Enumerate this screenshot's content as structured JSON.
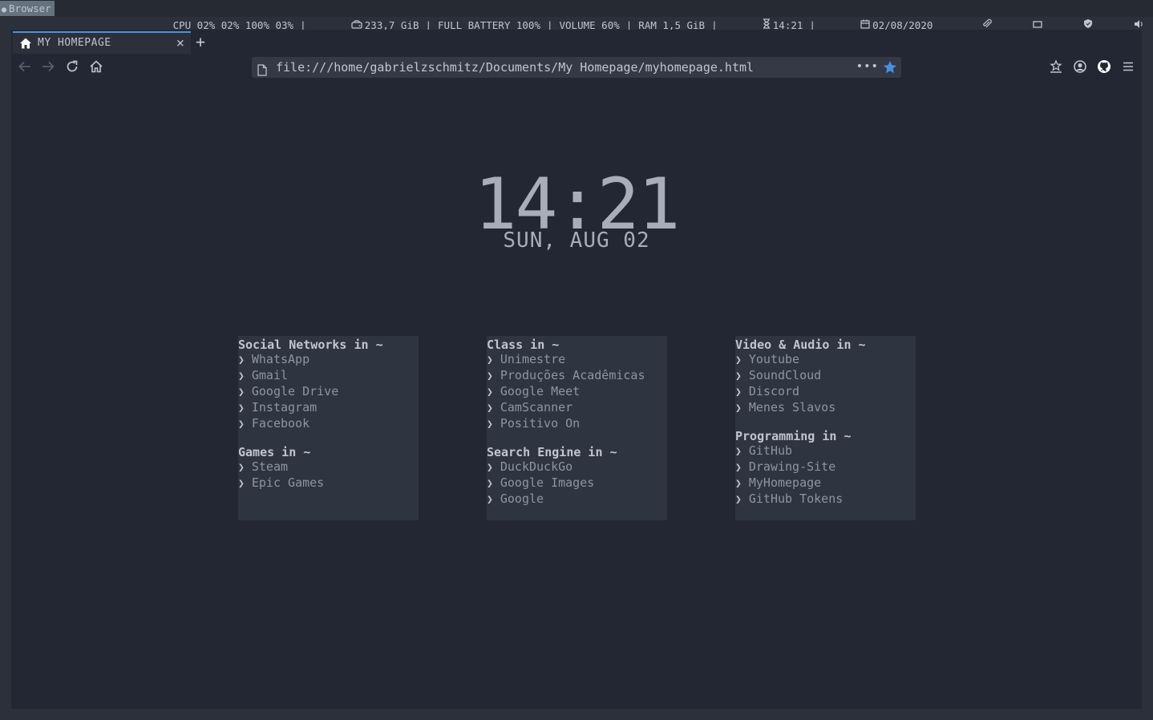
{
  "sysbar": {
    "workspace": "Browser",
    "cpu": "CPU 02% 02% 100% 03%",
    "disk": "233,7 GiB",
    "battery": "FULL BATTERY 100%",
    "volume": "VOLUME 60%",
    "ram": "RAM 1,5 GiB",
    "time": "14:21",
    "date": "02/08/2020",
    "icons": [
      "disk-icon",
      "hourglass-icon",
      "calendar-icon",
      "paperclip-icon",
      "window-icon",
      "shield-icon",
      "speaker-icon"
    ]
  },
  "browser": {
    "tab_title": "MY HOMEPAGE",
    "url": "file:///home/gabrielzschmitz/Documents/My Homepage/myhomepage.html",
    "accent": "#4a90e2"
  },
  "page": {
    "clock": "14:21",
    "date": "SUN, AUG 02",
    "columns": [
      {
        "groups": [
          {
            "heading": "Social Networks in ~",
            "links": [
              "WhatsApp",
              "Gmail",
              "Google Drive",
              "Instagram",
              "Facebook"
            ]
          },
          {
            "heading": "Games in ~",
            "links": [
              "Steam",
              "Epic Games"
            ]
          }
        ]
      },
      {
        "groups": [
          {
            "heading": "Class in ~",
            "links": [
              "Unimestre",
              "Produções Acadêmicas",
              "Google Meet",
              "CamScanner",
              "Positivo On"
            ]
          },
          {
            "heading": "Search Engine in ~",
            "links": [
              "DuckDuckGo",
              "Google Images",
              "Google"
            ]
          }
        ]
      },
      {
        "groups": [
          {
            "heading": "Video & Audio in ~",
            "links": [
              "Youtube",
              "SoundCloud",
              "Discord",
              "Menes Slavos"
            ]
          },
          {
            "heading": "Programming in ~",
            "links": [
              "GitHub",
              "Drawing-Site",
              "MyHomepage",
              "GitHub Tokens"
            ]
          }
        ]
      }
    ]
  },
  "colors": {
    "background": "#232733",
    "card": "#2f3441",
    "text": "#a7adba"
  }
}
